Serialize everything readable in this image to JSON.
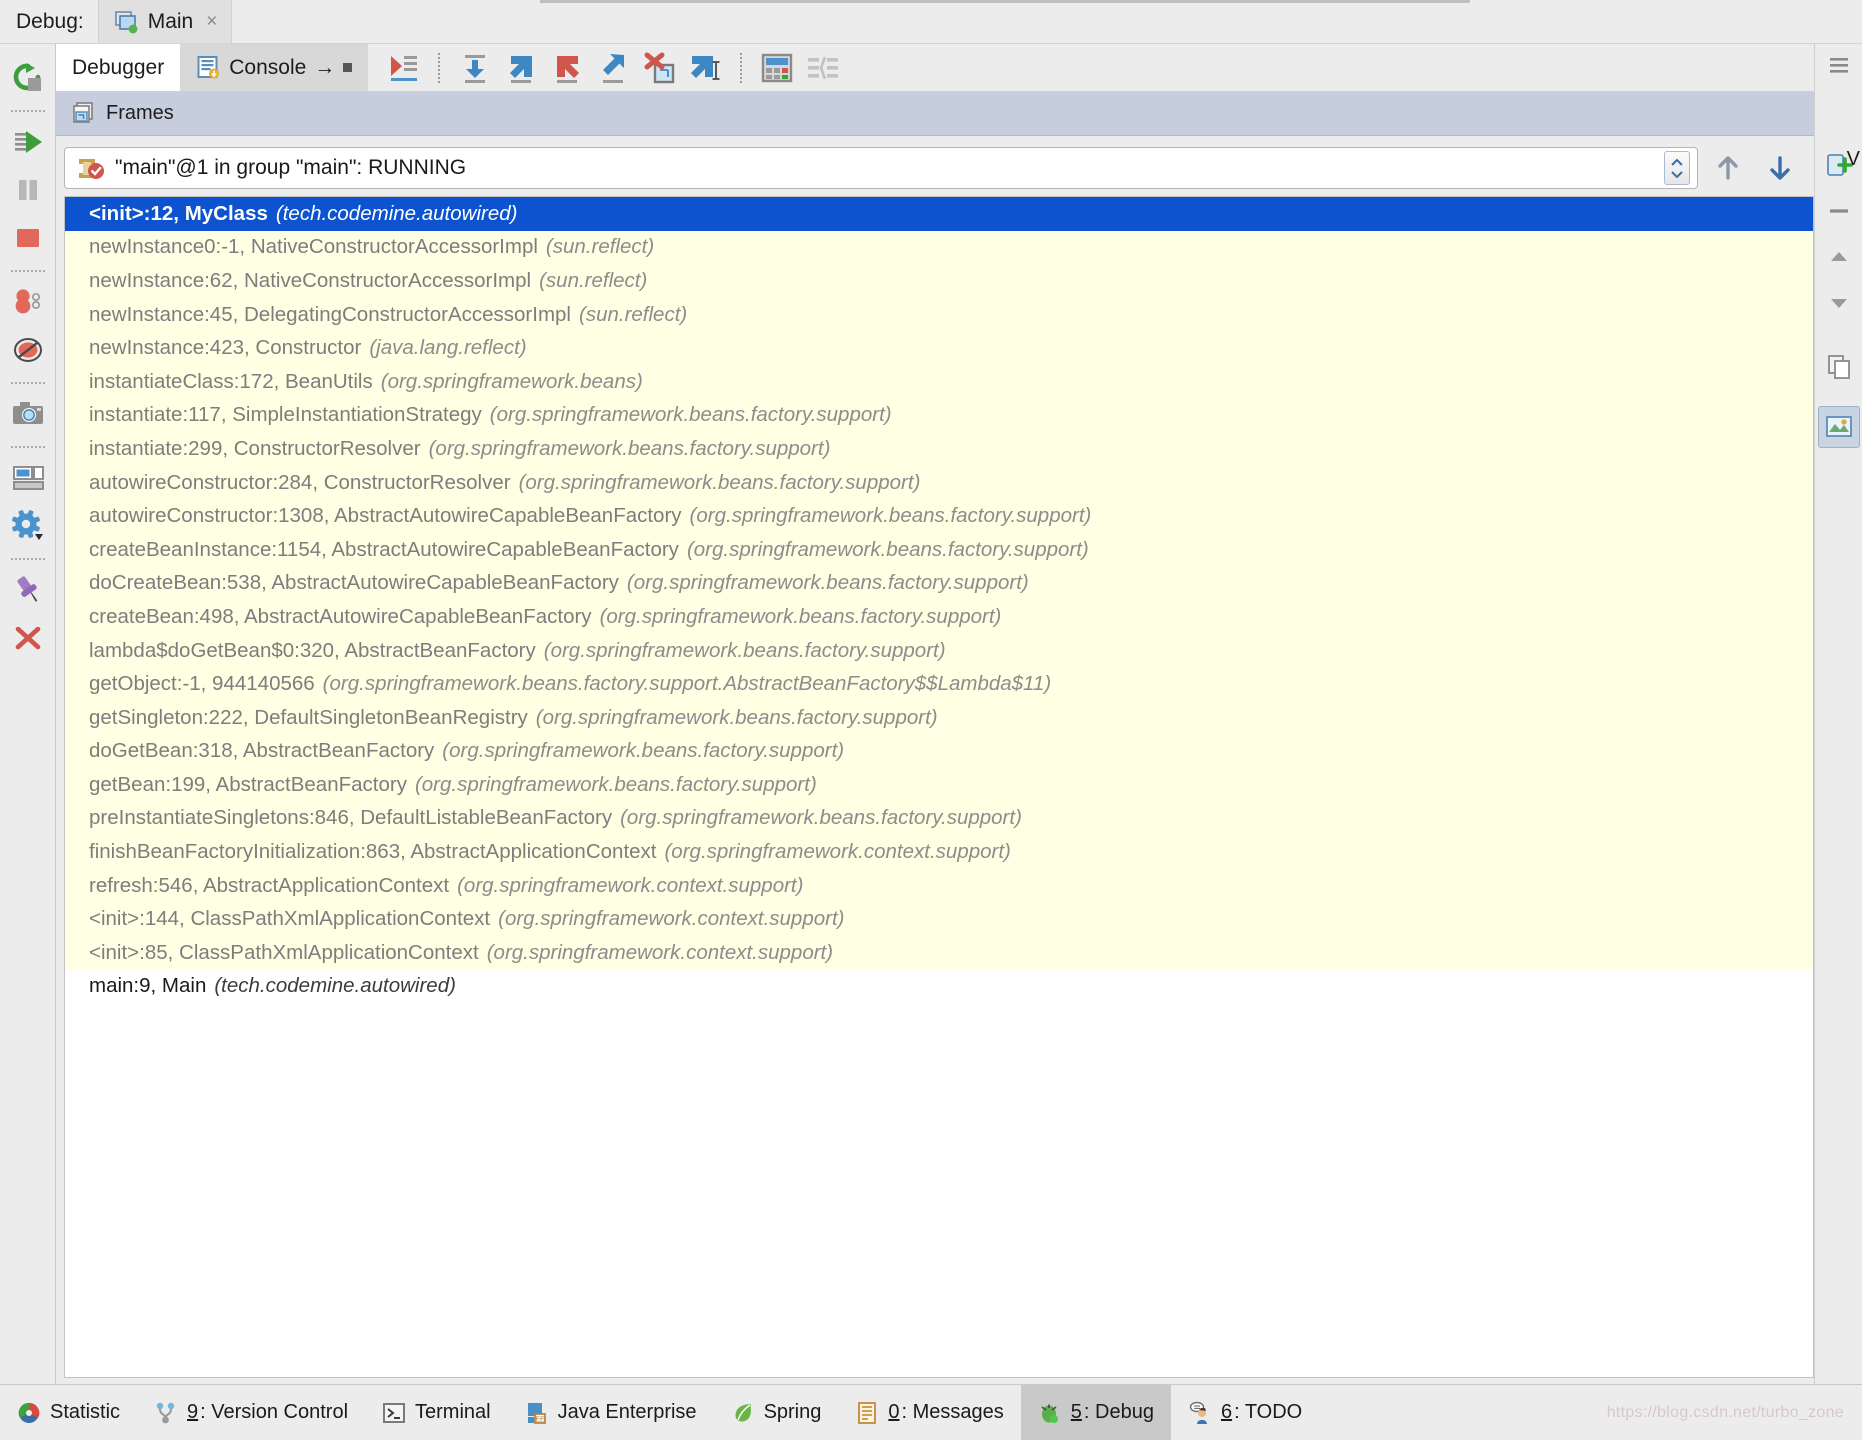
{
  "titlebar": {
    "label": "Debug:",
    "run_tab": {
      "title": "Main",
      "icon": "run-config-icon",
      "close": "×"
    }
  },
  "left_toolbar": {
    "buttons": [
      {
        "name": "rerun-button",
        "label": "Rerun"
      },
      {
        "name": "resume-program-button",
        "label": "Resume Program"
      },
      {
        "name": "pause-program-button",
        "label": "Pause Program"
      },
      {
        "name": "stop-button",
        "label": "Stop"
      },
      {
        "name": "view-breakpoints-button",
        "label": "View Breakpoints"
      },
      {
        "name": "mute-breakpoints-button",
        "label": "Mute Breakpoints"
      },
      {
        "name": "get-thread-dump-button",
        "label": "Get Thread Dump"
      },
      {
        "name": "restore-layout-button",
        "label": "Restore Layout"
      },
      {
        "name": "settings-button",
        "label": "Settings"
      },
      {
        "name": "pin-tab-button",
        "label": "Pin Tab"
      },
      {
        "name": "close-button",
        "label": "Close"
      }
    ]
  },
  "tabs": [
    {
      "label": "Debugger",
      "active": true,
      "icon": ""
    },
    {
      "label": "Console",
      "active": false,
      "icon": "console-icon",
      "suffix": "→"
    }
  ],
  "debug_toolbar": {
    "buttons": [
      {
        "name": "show-execution-point-button",
        "label": "Show Execution Point"
      },
      {
        "name": "step-over-button",
        "label": "Step Over"
      },
      {
        "name": "step-into-button",
        "label": "Step Into"
      },
      {
        "name": "force-step-into-button",
        "label": "Force Step Into"
      },
      {
        "name": "step-out-button",
        "label": "Step Out"
      },
      {
        "name": "drop-frame-button",
        "label": "Drop Frame"
      },
      {
        "name": "run-to-cursor-button",
        "label": "Run to Cursor"
      },
      {
        "name": "evaluate-expression-button",
        "label": "Evaluate Expression"
      },
      {
        "name": "watches-button",
        "label": "Watches"
      }
    ]
  },
  "frames_panel": {
    "title": "Frames",
    "header_icon": "frames-icon",
    "thread": {
      "text": "\"main\"@1 in group \"main\": RUNNING",
      "icon": "thread-running-icon"
    },
    "nav": {
      "up_label": "Up",
      "down_label": "Down",
      "filter_label": "Filter"
    },
    "frames": [
      {
        "method": "<init>:12, MyClass",
        "package": "(tech.codemine.autowired)",
        "kind": "selected"
      },
      {
        "method": "newInstance0:-1, NativeConstructorAccessorImpl",
        "package": "(sun.reflect)",
        "kind": "lib"
      },
      {
        "method": "newInstance:62, NativeConstructorAccessorImpl",
        "package": "(sun.reflect)",
        "kind": "lib"
      },
      {
        "method": "newInstance:45, DelegatingConstructorAccessorImpl",
        "package": "(sun.reflect)",
        "kind": "lib"
      },
      {
        "method": "newInstance:423, Constructor",
        "package": "(java.lang.reflect)",
        "kind": "lib"
      },
      {
        "method": "instantiateClass:172, BeanUtils",
        "package": "(org.springframework.beans)",
        "kind": "lib"
      },
      {
        "method": "instantiate:117, SimpleInstantiationStrategy",
        "package": "(org.springframework.beans.factory.support)",
        "kind": "lib"
      },
      {
        "method": "instantiate:299, ConstructorResolver",
        "package": "(org.springframework.beans.factory.support)",
        "kind": "lib"
      },
      {
        "method": "autowireConstructor:284, ConstructorResolver",
        "package": "(org.springframework.beans.factory.support)",
        "kind": "lib"
      },
      {
        "method": "autowireConstructor:1308, AbstractAutowireCapableBeanFactory",
        "package": "(org.springframework.beans.factory.support)",
        "kind": "lib"
      },
      {
        "method": "createBeanInstance:1154, AbstractAutowireCapableBeanFactory",
        "package": "(org.springframework.beans.factory.support)",
        "kind": "lib"
      },
      {
        "method": "doCreateBean:538, AbstractAutowireCapableBeanFactory",
        "package": "(org.springframework.beans.factory.support)",
        "kind": "lib"
      },
      {
        "method": "createBean:498, AbstractAutowireCapableBeanFactory",
        "package": "(org.springframework.beans.factory.support)",
        "kind": "lib"
      },
      {
        "method": "lambda$doGetBean$0:320, AbstractBeanFactory",
        "package": "(org.springframework.beans.factory.support)",
        "kind": "lib"
      },
      {
        "method": "getObject:-1, 944140566",
        "package": "(org.springframework.beans.factory.support.AbstractBeanFactory$$Lambda$11)",
        "kind": "lib"
      },
      {
        "method": "getSingleton:222, DefaultSingletonBeanRegistry",
        "package": "(org.springframework.beans.factory.support)",
        "kind": "lib"
      },
      {
        "method": "doGetBean:318, AbstractBeanFactory",
        "package": "(org.springframework.beans.factory.support)",
        "kind": "lib"
      },
      {
        "method": "getBean:199, AbstractBeanFactory",
        "package": "(org.springframework.beans.factory.support)",
        "kind": "lib"
      },
      {
        "method": "preInstantiateSingletons:846, DefaultListableBeanFactory",
        "package": "(org.springframework.beans.factory.support)",
        "kind": "lib"
      },
      {
        "method": "finishBeanFactoryInitialization:863, AbstractApplicationContext",
        "package": "(org.springframework.context.support)",
        "kind": "lib"
      },
      {
        "method": "refresh:546, AbstractApplicationContext",
        "package": "(org.springframework.context.support)",
        "kind": "lib"
      },
      {
        "method": "<init>:144, ClassPathXmlApplicationContext",
        "package": "(org.springframework.context.support)",
        "kind": "lib"
      },
      {
        "method": "<init>:85, ClassPathXmlApplicationContext",
        "package": "(org.springframework.context.support)",
        "kind": "lib"
      },
      {
        "method": "main:9, Main",
        "package": "(tech.codemine.autowired)",
        "kind": "app"
      }
    ]
  },
  "variables_panel": {
    "label": "V",
    "buttons": [
      {
        "name": "add-watch-button",
        "label": "Add Watch"
      },
      {
        "name": "remove-watch-button",
        "label": "Remove Watch"
      },
      {
        "name": "move-watch-up-button",
        "label": "Move Up"
      },
      {
        "name": "move-watch-down-button",
        "label": "Move Down"
      },
      {
        "name": "copy-value-button",
        "label": "Copy Value"
      },
      {
        "name": "inspect-button",
        "label": "Inspect"
      }
    ]
  },
  "status_bar": {
    "items": [
      {
        "name": "statusbar-statistic",
        "label": "Statistic",
        "mnemonic": "",
        "icon": "statistic-icon",
        "active": false
      },
      {
        "name": "statusbar-version-control",
        "label": ": Version Control",
        "mnemonic": "9",
        "icon": "version-control-icon",
        "active": false
      },
      {
        "name": "statusbar-terminal",
        "label": "Terminal",
        "mnemonic": "",
        "icon": "terminal-icon",
        "active": false
      },
      {
        "name": "statusbar-java-enterprise",
        "label": "Java Enterprise",
        "mnemonic": "",
        "icon": "java-enterprise-icon",
        "active": false
      },
      {
        "name": "statusbar-spring",
        "label": "Spring",
        "mnemonic": "",
        "icon": "spring-icon",
        "active": false
      },
      {
        "name": "statusbar-messages",
        "label": ": Messages",
        "mnemonic": "0",
        "icon": "messages-icon",
        "active": false
      },
      {
        "name": "statusbar-debug",
        "label": ": Debug",
        "mnemonic": "5",
        "icon": "debug-icon",
        "active": true
      },
      {
        "name": "statusbar-todo",
        "label": ": TODO",
        "mnemonic": "6",
        "icon": "todo-icon",
        "active": false
      }
    ],
    "watermark": "https://blog.csdn.net/turbo_zone"
  },
  "colors": {
    "selection_blue": "#0D52CE",
    "library_frame_bg": "#FFFFE4",
    "frames_header_bg": "#C6CEDD",
    "chrome_bg": "#ECECEC"
  }
}
